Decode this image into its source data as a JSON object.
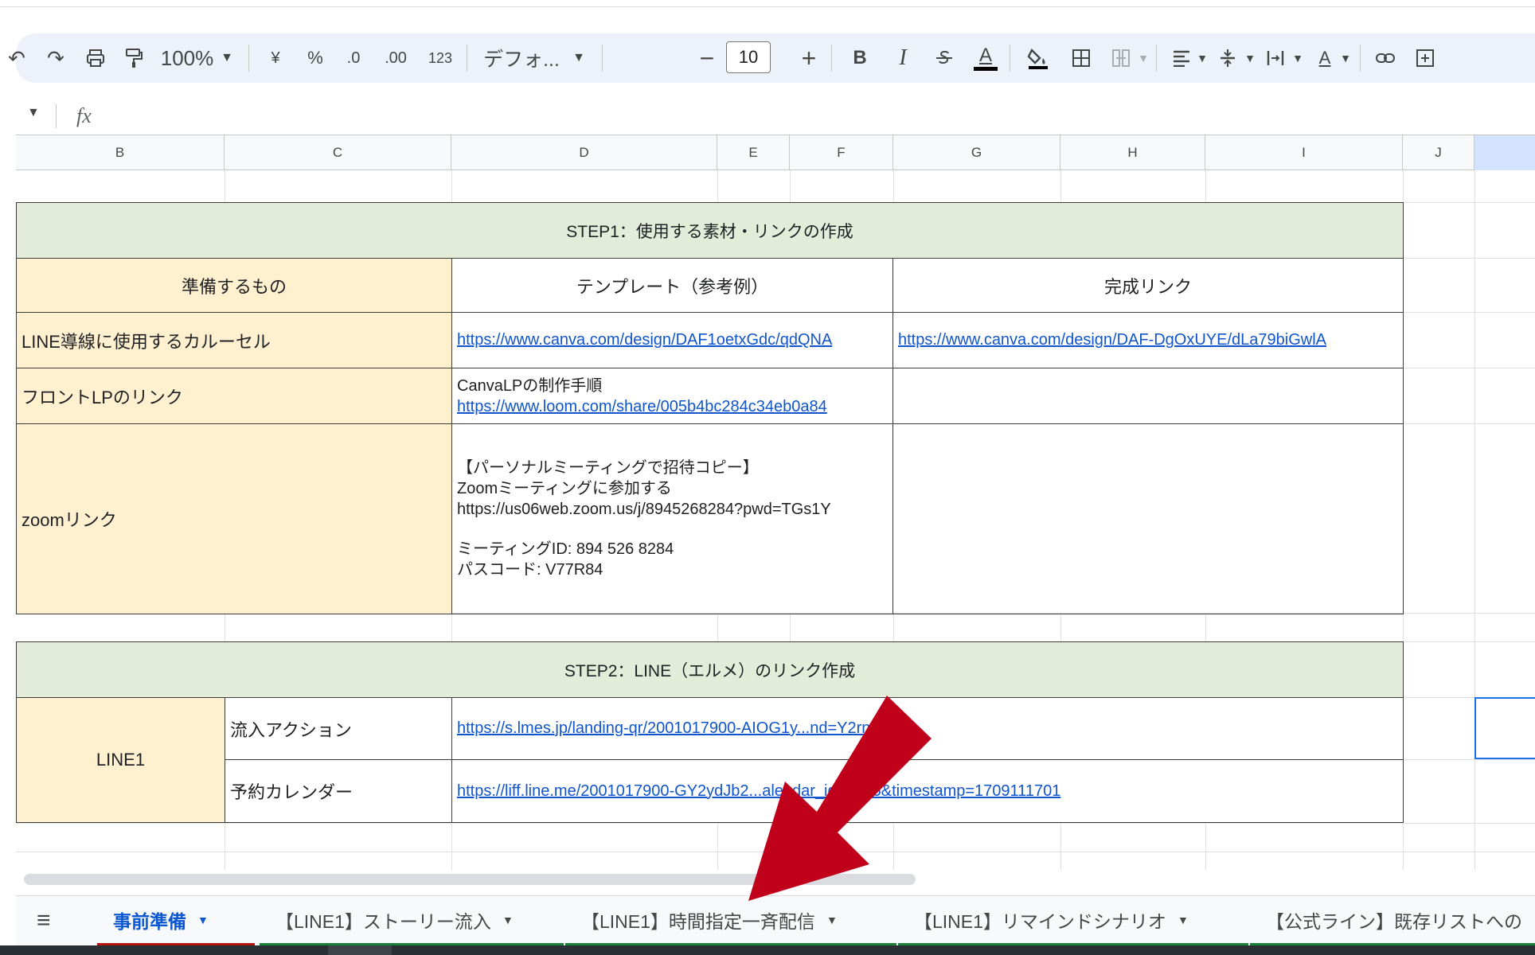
{
  "toolbar": {
    "zoom": "100%",
    "currency": "¥",
    "percent": "%",
    "dec_decrease": ".0",
    "dec_increase": ".00",
    "number_format": "123",
    "font": "デフォ...",
    "font_size": "10",
    "minus": "−",
    "plus": "+",
    "bold": "B",
    "italic": "I",
    "strike": "S",
    "text_color": "A"
  },
  "formula_bar": {
    "fx": "fx"
  },
  "columns": [
    "B",
    "C",
    "D",
    "E",
    "F",
    "G",
    "H",
    "I",
    "J"
  ],
  "sheet": {
    "step1_header": "STEP1：使用する素材・リンクの作成",
    "head_prepare": "準備するもの",
    "head_template": "テンプレート（参考例）",
    "head_done": "完成リンク",
    "row_carousel_label": "LINE導線に使用するカルーセル",
    "row_carousel_template": "https://www.canva.com/design/DAF1oetxGdc/qdQNA",
    "row_carousel_done": "https://www.canva.com/design/DAF-DgOxUYE/dLa79biGwlA",
    "row_lp_label": "フロントLPのリンク",
    "row_lp_line1": "CanvaLPの制作手順",
    "row_lp_line2": "https://www.loom.com/share/005b4bc284c34eb0a84",
    "row_zoom_label": "zoomリンク",
    "zoom_l1": "【パーソナルミーティングで招待コピー】",
    "zoom_l2": "Zoomミーティングに参加する",
    "zoom_l3": "https://us06web.zoom.us/j/8945268284?pwd=TGs1Y",
    "zoom_l4": "ミーティングID: 894 526 8284",
    "zoom_l5": "パスコード: V77R84",
    "step2_header": "STEP2：LINE（エルメ）のリンク作成",
    "line1_label": "LINE1",
    "inflow_label": "流入アクション",
    "inflow_link": "https://s.lmes.jp/landing-qr/2001017900-AIOG1y...nd=Y2rnsX",
    "calendar_label": "予約カレンダー",
    "calendar_link": "https://liff.line.me/2001017900-GY2ydJb2...alendar_id=8805&timestamp=1709111701"
  },
  "tabs": {
    "menu_icon": "≡",
    "t1": "事前準備",
    "t2": "【LINE1】ストーリー流入",
    "t3": "【LINE1】時間指定一斉配信",
    "t4": "【LINE1】リマインドシナリオ",
    "t5": "【公式ライン】既存リストへの"
  },
  "colors": {
    "green_header": "#e2ecd9",
    "peach_cell": "#fff0cf",
    "link": "#1155cc",
    "arrow": "#c0001a",
    "active_tab": "#0b57d0"
  }
}
